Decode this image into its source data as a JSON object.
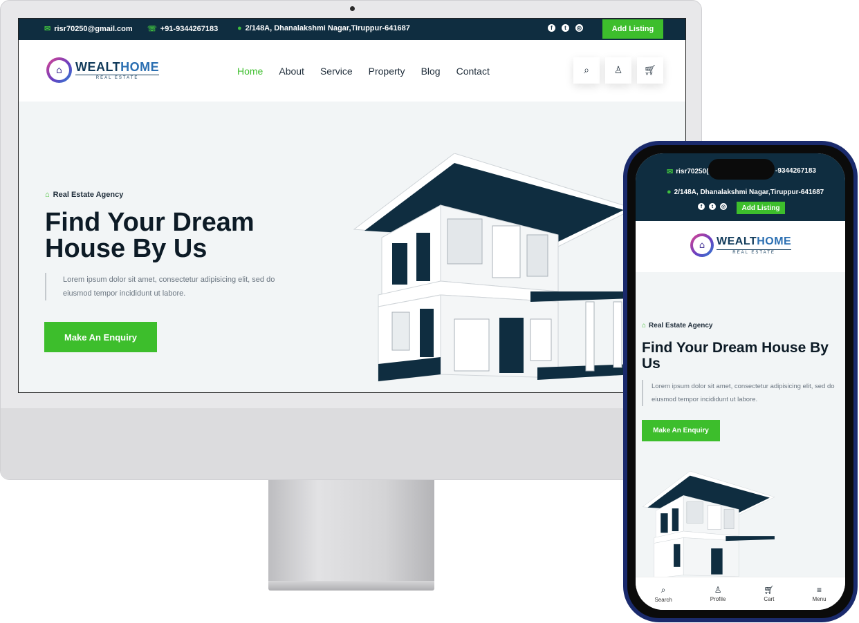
{
  "topbar": {
    "email": "risr70250@gmail.com",
    "phone": "+91-9344267183",
    "address": "2/148A, Dhanalakshmi Nagar,Tiruppur-641687",
    "add_listing": "Add Listing"
  },
  "brand": {
    "name_part1": "WEALT",
    "name_part2": "HOME",
    "tagline": "REAL ESTATE"
  },
  "nav": {
    "items": [
      "Home",
      "About",
      "Service",
      "Property",
      "Blog",
      "Contact"
    ],
    "active": "Home"
  },
  "hero": {
    "badge": "Real Estate Agency",
    "title_desktop": "Find Your Dream House By Us",
    "title_mobile": "Find Your Dream House By Us",
    "description": "Lorem ipsum dolor sit amet, consectetur adipisicing elit, sed do eiusmod tempor incididunt ut labore.",
    "cta": "Make An Enquiry"
  },
  "mobile": {
    "email_fragment": "risr70250(",
    "phone_fragment": "-9344267183",
    "bottom_tabs": [
      "Search",
      "Profile",
      "Cart",
      "Menu"
    ]
  },
  "colors": {
    "accent_green": "#3dbe2c",
    "navy": "#0f2d40",
    "hero_bg": "#f2f5f6"
  },
  "icons": [
    "mail-icon",
    "phone-icon",
    "location-icon",
    "facebook-icon",
    "twitter-icon",
    "instagram-icon",
    "search-icon",
    "user-icon",
    "cart-icon",
    "home-icon",
    "menu-icon"
  ]
}
